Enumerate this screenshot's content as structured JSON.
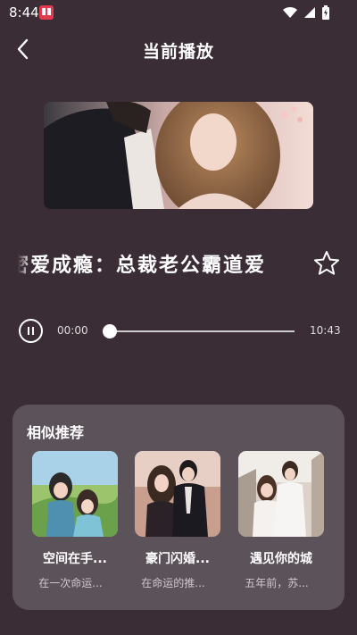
{
  "status_bar": {
    "time": "8:44",
    "icons": [
      "app-notification-icon",
      "wifi-icon",
      "cell-signal-icon",
      "battery-icon"
    ]
  },
  "header": {
    "title": "当前播放",
    "back_icon": "chevron-left-icon"
  },
  "now_playing": {
    "title": "密爱成瘾：总裁老公霸道爱",
    "favorite_icon": "star-outline-icon",
    "cover_icon": "cover-art"
  },
  "player": {
    "play_state_icon": "pause-icon",
    "current_time": "00:00",
    "total_time": "10:43",
    "progress": 0
  },
  "recommend": {
    "title": "相似推荐",
    "items": [
      {
        "title": "空间在手...",
        "desc": "在一次命运...",
        "icon": "cover-art"
      },
      {
        "title": "豪门闪婚...",
        "desc": "在命运的推...",
        "icon": "cover-art"
      },
      {
        "title": "遇见你的城",
        "desc": "五年前，苏...",
        "icon": "cover-art"
      }
    ]
  },
  "colors": {
    "background": "#3a2d35",
    "panel": "#5c535a",
    "text": "#ffffff"
  }
}
